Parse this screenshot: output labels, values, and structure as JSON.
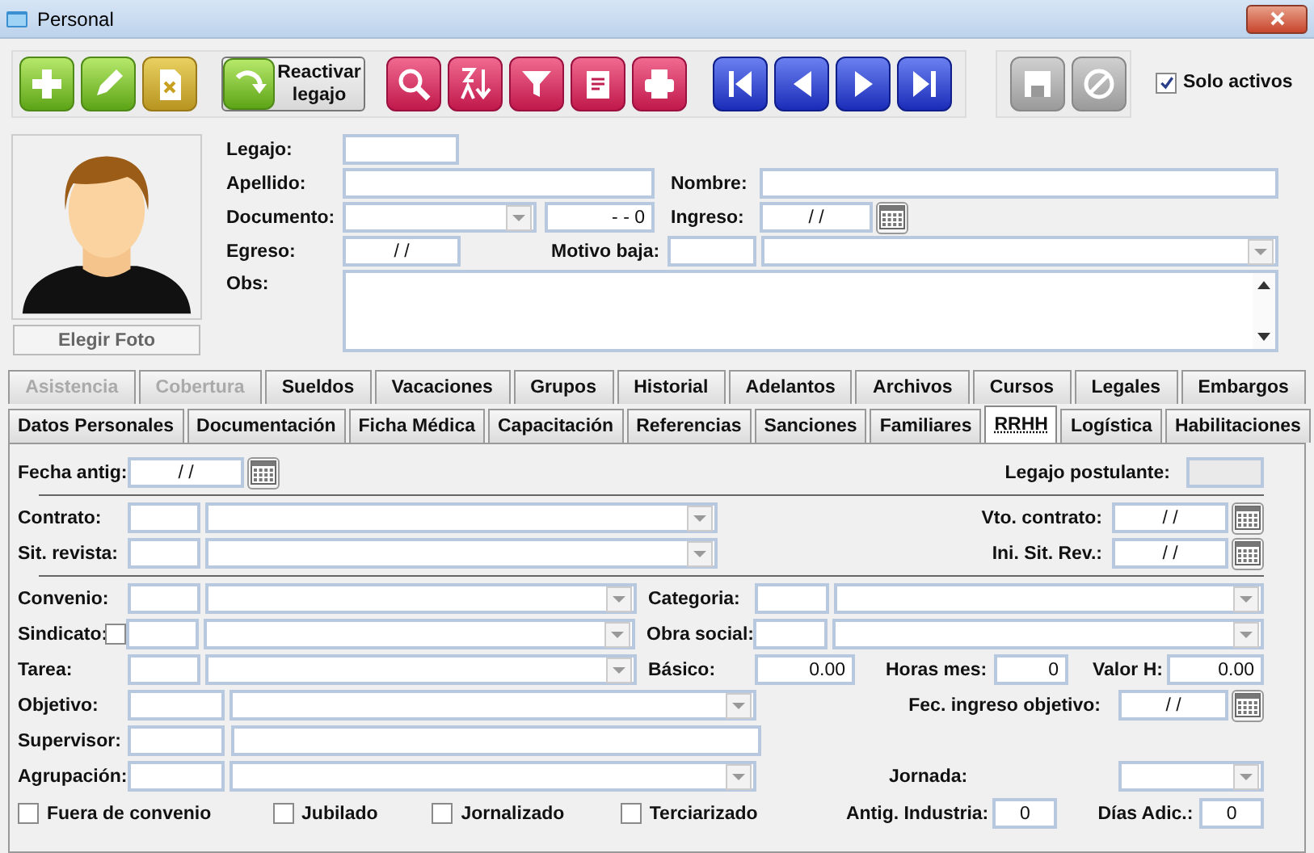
{
  "window": {
    "title": "Personal"
  },
  "toolbar": {
    "groups": [
      {
        "buttons": [
          {
            "kind": "add",
            "disabled": false
          },
          {
            "kind": "edit",
            "disabled": false
          },
          {
            "kind": "delete",
            "disabled": false
          },
          {
            "kind": "reactivate",
            "label": "Reactivar legajo",
            "disabled": false
          },
          {
            "kind": "search",
            "disabled": false
          },
          {
            "kind": "sort",
            "disabled": false
          },
          {
            "kind": "filter",
            "disabled": false
          },
          {
            "kind": "report",
            "disabled": false
          },
          {
            "kind": "print",
            "disabled": false
          },
          {
            "kind": "first",
            "disabled": false
          },
          {
            "kind": "prev",
            "disabled": false
          },
          {
            "kind": "next",
            "disabled": false
          },
          {
            "kind": "last",
            "disabled": false
          }
        ]
      },
      {
        "buttons": [
          {
            "kind": "save",
            "disabled": true
          },
          {
            "kind": "cancel",
            "disabled": true
          }
        ]
      }
    ],
    "solo_activos": {
      "label": "Solo activos",
      "checked": true
    }
  },
  "photo": {
    "button": "Elegir Foto"
  },
  "header": {
    "legajo": {
      "label": "Legajo:"
    },
    "apellido": {
      "label": "Apellido:"
    },
    "nombre": {
      "label": "Nombre:"
    },
    "documento": {
      "label": "Documento:",
      "number": "-  -  0"
    },
    "ingreso": {
      "label": "Ingreso:",
      "value": "/ /"
    },
    "egreso": {
      "label": "Egreso:",
      "value": "/ /"
    },
    "motivo_baja": {
      "label": "Motivo baja:"
    },
    "obs": {
      "label": "Obs:"
    }
  },
  "tabs_row_1": [
    {
      "label": "Asistencia",
      "disabled": true,
      "selected": false
    },
    {
      "label": "Cobertura",
      "disabled": true,
      "selected": false
    },
    {
      "label": "Sueldos",
      "disabled": false,
      "selected": false
    },
    {
      "label": "Vacaciones",
      "disabled": false,
      "selected": false
    },
    {
      "label": "Grupos",
      "disabled": false,
      "selected": false
    },
    {
      "label": "Historial",
      "disabled": false,
      "selected": false
    },
    {
      "label": "Adelantos",
      "disabled": false,
      "selected": false
    },
    {
      "label": "Archivos",
      "disabled": false,
      "selected": false
    },
    {
      "label": "Cursos",
      "disabled": false,
      "selected": false
    },
    {
      "label": "Legales",
      "disabled": false,
      "selected": false
    },
    {
      "label": "Embargos",
      "disabled": false,
      "selected": false
    }
  ],
  "tabs_row_2": [
    {
      "label": "Datos Personales",
      "disabled": false,
      "selected": false
    },
    {
      "label": "Documentación",
      "disabled": false,
      "selected": false
    },
    {
      "label": "Ficha Médica",
      "disabled": false,
      "selected": false
    },
    {
      "label": "Capacitación",
      "disabled": false,
      "selected": false
    },
    {
      "label": "Referencias",
      "disabled": false,
      "selected": false
    },
    {
      "label": "Sanciones",
      "disabled": false,
      "selected": false
    },
    {
      "label": "Familiares",
      "disabled": false,
      "selected": false
    },
    {
      "label": "RRHH",
      "disabled": false,
      "selected": true
    },
    {
      "label": "Logística",
      "disabled": false,
      "selected": false
    },
    {
      "label": "Habilitaciones",
      "disabled": false,
      "selected": false
    }
  ],
  "rrhh": {
    "fecha_antig": {
      "label": "Fecha antig:",
      "value": "/ /"
    },
    "legajo_postulante": {
      "label": "Legajo postulante:"
    },
    "contrato": {
      "label": "Contrato:"
    },
    "vto_contrato": {
      "label": "Vto. contrato:",
      "value": "/ /"
    },
    "sit_revista": {
      "label": "Sit. revista:"
    },
    "ini_sit_rev": {
      "label": "Ini. Sit. Rev.:",
      "value": "/ /"
    },
    "convenio": {
      "label": "Convenio:"
    },
    "categoria": {
      "label": "Categoria:"
    },
    "sindicato": {
      "label": "Sindicato:",
      "checked": false
    },
    "obra_social": {
      "label": "Obra social:"
    },
    "tarea": {
      "label": "Tarea:"
    },
    "basico": {
      "label": "Básico:",
      "value": "0.00"
    },
    "horas_mes": {
      "label": "Horas mes:",
      "value": "0"
    },
    "valor_h": {
      "label": "Valor H:",
      "value": "0.00"
    },
    "objetivo": {
      "label": "Objetivo:"
    },
    "fec_ingreso_objetivo": {
      "label": "Fec. ingreso objetivo:",
      "value": "/ /"
    },
    "supervisor": {
      "label": "Supervisor:"
    },
    "agrupacion": {
      "label": "Agrupación:"
    },
    "jornada": {
      "label": "Jornada:"
    },
    "flags": [
      {
        "label": "Fuera de convenio",
        "checked": false
      },
      {
        "label": "Jubilado",
        "checked": false
      },
      {
        "label": "Jornalizado",
        "checked": false
      },
      {
        "label": "Terciarizado",
        "checked": false
      }
    ],
    "antig_industria": {
      "label": "Antig. Industria:",
      "value": "0"
    },
    "dias_adic": {
      "label": "Días Adic.:",
      "value": "0"
    }
  }
}
